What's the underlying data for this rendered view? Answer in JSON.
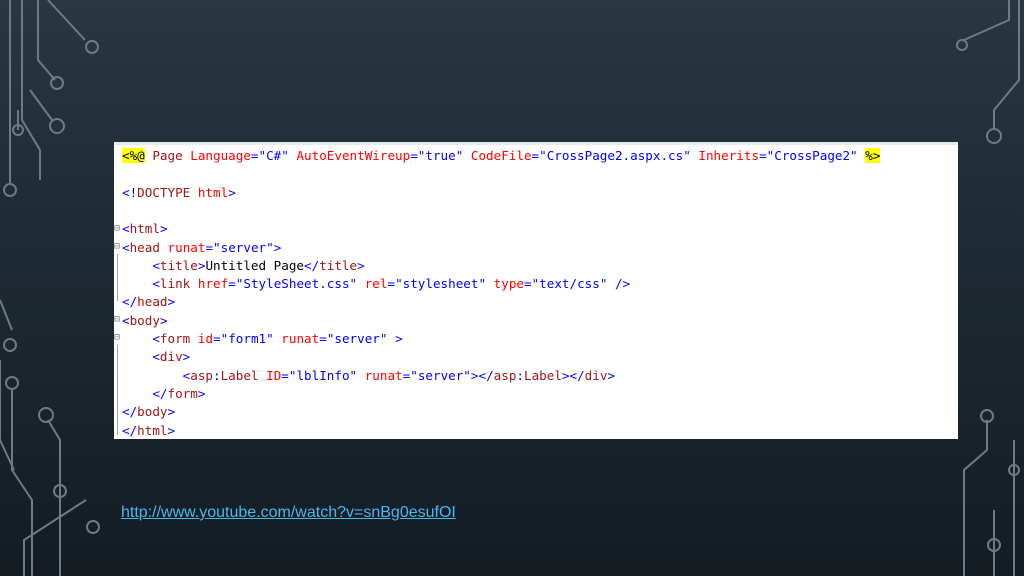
{
  "code": {
    "lines": [
      [
        [
          "<%@",
          "dir"
        ],
        [
          " Page ",
          "maroon"
        ],
        [
          "Language",
          "red"
        ],
        [
          "=",
          "blue"
        ],
        [
          "\"C#\"",
          "blue"
        ],
        [
          " ",
          "black"
        ],
        [
          "AutoEventWireup",
          "red"
        ],
        [
          "=",
          "blue"
        ],
        [
          "\"true\"",
          "blue"
        ],
        [
          " ",
          "black"
        ],
        [
          "CodeFile",
          "red"
        ],
        [
          "=",
          "blue"
        ],
        [
          "\"CrossPage2.aspx.cs\"",
          "blue"
        ],
        [
          " ",
          "black"
        ],
        [
          "Inherits",
          "red"
        ],
        [
          "=",
          "blue"
        ],
        [
          "\"CrossPage2\"",
          "blue"
        ],
        [
          " ",
          "black"
        ],
        [
          "%>",
          "dir"
        ]
      ],
      [],
      [
        [
          "<!",
          "blue"
        ],
        [
          "DOCTYPE",
          "maroon"
        ],
        [
          " ",
          "black"
        ],
        [
          "html",
          "red"
        ],
        [
          ">",
          "blue"
        ]
      ],
      [],
      [
        [
          "<",
          "blue"
        ],
        [
          "html",
          "maroon"
        ],
        [
          ">",
          "blue"
        ]
      ],
      [
        [
          "<",
          "blue"
        ],
        [
          "head",
          "maroon"
        ],
        [
          " ",
          "black"
        ],
        [
          "runat",
          "red"
        ],
        [
          "=",
          "blue"
        ],
        [
          "\"server\"",
          "blue"
        ],
        [
          ">",
          "blue"
        ]
      ],
      [
        [
          "    <",
          "blue"
        ],
        [
          "title",
          "maroon"
        ],
        [
          ">",
          "blue"
        ],
        [
          "Untitled Page",
          "black"
        ],
        [
          "</",
          "blue"
        ],
        [
          "title",
          "maroon"
        ],
        [
          ">",
          "blue"
        ]
      ],
      [
        [
          "    <",
          "blue"
        ],
        [
          "link",
          "maroon"
        ],
        [
          " ",
          "black"
        ],
        [
          "href",
          "red"
        ],
        [
          "=",
          "blue"
        ],
        [
          "\"StyleSheet.css\"",
          "blue"
        ],
        [
          " ",
          "black"
        ],
        [
          "rel",
          "red"
        ],
        [
          "=",
          "blue"
        ],
        [
          "\"stylesheet\"",
          "blue"
        ],
        [
          " ",
          "black"
        ],
        [
          "type",
          "red"
        ],
        [
          "=",
          "blue"
        ],
        [
          "\"text/css\"",
          "blue"
        ],
        [
          " />",
          "blue"
        ]
      ],
      [
        [
          "</",
          "blue"
        ],
        [
          "head",
          "maroon"
        ],
        [
          ">",
          "blue"
        ]
      ],
      [
        [
          "<",
          "blue"
        ],
        [
          "body",
          "maroon"
        ],
        [
          ">",
          "blue"
        ]
      ],
      [
        [
          "    <",
          "blue"
        ],
        [
          "form",
          "maroon"
        ],
        [
          " ",
          "black"
        ],
        [
          "id",
          "red"
        ],
        [
          "=",
          "blue"
        ],
        [
          "\"form1\"",
          "blue"
        ],
        [
          " ",
          "black"
        ],
        [
          "runat",
          "red"
        ],
        [
          "=",
          "blue"
        ],
        [
          "\"server\"",
          "blue"
        ],
        [
          " >",
          "blue"
        ]
      ],
      [
        [
          "    <",
          "blue"
        ],
        [
          "div",
          "maroon"
        ],
        [
          ">",
          "blue"
        ]
      ],
      [
        [
          "        <",
          "blue"
        ],
        [
          "asp",
          "maroon"
        ],
        [
          ":",
          "blue"
        ],
        [
          "Label",
          "maroon"
        ],
        [
          " ",
          "black"
        ],
        [
          "ID",
          "red"
        ],
        [
          "=",
          "blue"
        ],
        [
          "\"lblInfo\"",
          "blue"
        ],
        [
          " ",
          "black"
        ],
        [
          "runat",
          "red"
        ],
        [
          "=",
          "blue"
        ],
        [
          "\"server\"",
          "blue"
        ],
        [
          "></",
          "blue"
        ],
        [
          "asp",
          "maroon"
        ],
        [
          ":",
          "blue"
        ],
        [
          "Label",
          "maroon"
        ],
        [
          "></",
          "blue"
        ],
        [
          "div",
          "maroon"
        ],
        [
          ">",
          "blue"
        ]
      ],
      [
        [
          "    </",
          "blue"
        ],
        [
          "form",
          "maroon"
        ],
        [
          ">",
          "blue"
        ]
      ],
      [
        [
          "</",
          "blue"
        ],
        [
          "body",
          "maroon"
        ],
        [
          ">",
          "blue"
        ]
      ],
      [
        [
          "</",
          "blue"
        ],
        [
          "html",
          "maroon"
        ],
        [
          ">",
          "blue"
        ]
      ]
    ],
    "colors": {
      "blue": "#0000ff",
      "maroon": "#a31515",
      "red": "#ff0000",
      "black": "#000000",
      "dir": "#ffff00"
    }
  },
  "link": {
    "text": "http://www.youtube.com/watch?v=snBg0esufOI"
  }
}
